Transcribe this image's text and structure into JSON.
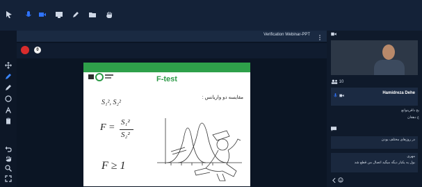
{
  "topbar": {
    "buttons": [
      {
        "name": "cursor-icon",
        "color": "#cfd8e6"
      },
      {
        "name": "microphone-icon",
        "color": "#2f74ff"
      },
      {
        "name": "video-camera-icon",
        "color": "#2f74ff"
      },
      {
        "name": "monitor-icon",
        "color": "#cfd8e6"
      },
      {
        "name": "pen-icon",
        "color": "#cfd8e6"
      },
      {
        "name": "folder-icon",
        "color": "#cfd8e6"
      },
      {
        "name": "hand-icon",
        "color": "#cfd8e6"
      }
    ]
  },
  "presentation": {
    "title": "Verification Webinar-PPT",
    "page_number": "0",
    "slide": {
      "title": "F-test",
      "subtitle": "مقایسه دو واریانس :",
      "formula_1": "S₁², S₂²",
      "formula_2_lhs": "F =",
      "formula_2_num": "S₁²",
      "formula_2_den": "S₂²",
      "formula_3": "F ≥ 1"
    }
  },
  "right_panel": {
    "participants_count": "10",
    "participant_name": "Hamidreza Dehe",
    "participant_sub1": "بخ داقرینوانع",
    "participant_sub2": "ع دهقان",
    "chat_1": "در روزهای مختلف بودن",
    "chat_2_line1": "مهری",
    "chat_2_line2": "بول یه یکبار دیگه میگید اتصال من قطع شد"
  }
}
